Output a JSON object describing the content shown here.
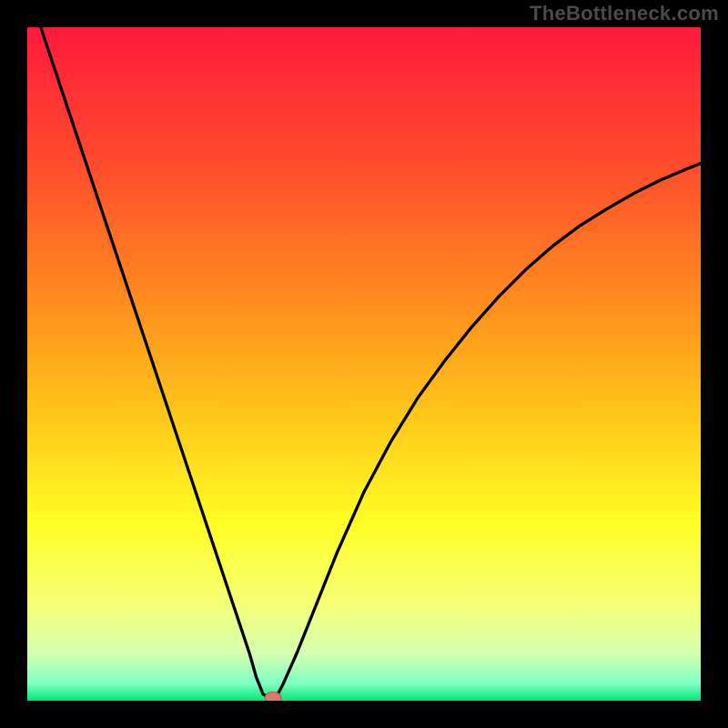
{
  "watermark": "TheBottleneck.com",
  "colors": {
    "frame": "#000000",
    "watermark": "#4a4a4a",
    "curve": "#000000",
    "marker_fill": "#d97a6e",
    "marker_stroke": "#b85a4f",
    "gradient_stops": [
      {
        "offset": 0.0,
        "color": "#ff1a3c"
      },
      {
        "offset": 0.2,
        "color": "#ff4b2d"
      },
      {
        "offset": 0.4,
        "color": "#ff8a1f"
      },
      {
        "offset": 0.58,
        "color": "#ffc81a"
      },
      {
        "offset": 0.74,
        "color": "#ffff26"
      },
      {
        "offset": 0.86,
        "color": "#f6ff7a"
      },
      {
        "offset": 0.93,
        "color": "#d4ffb0"
      },
      {
        "offset": 0.975,
        "color": "#7dffc2"
      },
      {
        "offset": 1.0,
        "color": "#00e676"
      }
    ]
  },
  "chart_data": {
    "type": "line",
    "title": "",
    "xlabel": "",
    "ylabel": "",
    "xlim": [
      0,
      100
    ],
    "ylim": [
      0,
      100
    ],
    "series": [
      {
        "name": "bottleneck-curve",
        "x": [
          2,
          4,
          6,
          8,
          10,
          12,
          14,
          16,
          18,
          20,
          22,
          24,
          26,
          28,
          30,
          31,
          32,
          33,
          34,
          35,
          36,
          37,
          38,
          40,
          42,
          44,
          46,
          48,
          50,
          54,
          58,
          62,
          66,
          70,
          74,
          78,
          82,
          86,
          90,
          94,
          98,
          100
        ],
        "y": [
          100,
          94,
          88,
          82,
          76,
          70,
          64,
          58,
          52,
          46,
          40,
          34,
          28,
          22,
          16,
          13,
          10,
          7,
          3.5,
          1,
          0.3,
          0.6,
          2.5,
          7,
          12,
          17,
          22,
          26.5,
          31,
          38.5,
          45,
          50.5,
          55.5,
          60,
          64,
          67.5,
          70.5,
          73,
          75.3,
          77.3,
          79,
          79.8
        ]
      }
    ],
    "marker": {
      "x": 36.5,
      "y": 0.4,
      "rx": 1.2,
      "ry": 0.9
    }
  }
}
